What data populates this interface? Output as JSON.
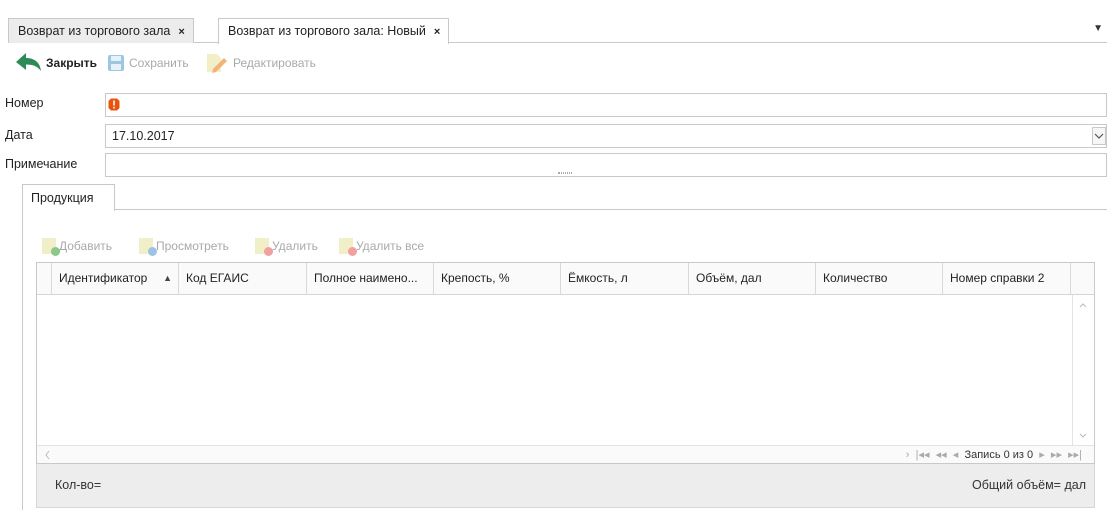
{
  "tabs": [
    {
      "label": "Возврат из торгового зала",
      "close": "×",
      "active": false
    },
    {
      "label": "Возврат из торгового зала: Новый",
      "close": "×",
      "active": true
    }
  ],
  "tab_menu_glyph": "▼",
  "toolbar": {
    "close_label": "Закрыть",
    "save_label": "Сохранить",
    "edit_label": "Редактировать"
  },
  "form": {
    "number_label": "Номер",
    "number_value": "",
    "date_label": "Дата",
    "date_value": "17.10.2017",
    "note_label": "Примечание",
    "note_value": ""
  },
  "inner_tab": {
    "label": "Продукция"
  },
  "grid_toolbar": {
    "add": "Добавить",
    "view": "Просмотреть",
    "delete": "Удалить",
    "delete_all": "Удалить все"
  },
  "table": {
    "columns": [
      "Идентификатор",
      "Код ЕГАИС",
      "Полное наимено...",
      "Крепость, %",
      "Ёмкость, л",
      "Объём, дал",
      "Количество",
      "Номер справки 2"
    ],
    "sort_indicator": "▲",
    "rows": []
  },
  "pager": {
    "text": "Запись 0 из 0"
  },
  "footer": {
    "count_label": "Кол-во=",
    "volume_label": "Общий объём= дал"
  },
  "colors": {
    "accent_green": "#2e8b57",
    "error_orange": "#e8540e",
    "disabled_text": "#a9a9a9"
  }
}
